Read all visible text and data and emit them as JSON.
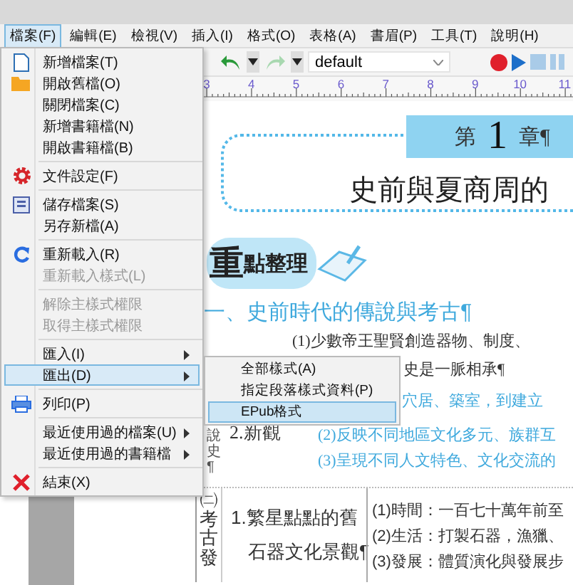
{
  "menu_bar": {
    "items": [
      {
        "label": "檔案(F)",
        "selected": true
      },
      {
        "label": "編輯(E)",
        "selected": false
      },
      {
        "label": "檢視(V)",
        "selected": false
      },
      {
        "label": "插入(I)",
        "selected": false
      },
      {
        "label": "格式(O)",
        "selected": false
      },
      {
        "label": "表格(A)",
        "selected": false
      },
      {
        "label": "書眉(P)",
        "selected": false
      },
      {
        "label": "工具(T)",
        "selected": false
      },
      {
        "label": "說明(H)",
        "selected": false
      }
    ]
  },
  "file_menu": {
    "items": [
      {
        "kind": "item",
        "label": "新增檔案(T)",
        "disabled": false,
        "submenu": false,
        "selected": false
      },
      {
        "kind": "item",
        "label": "開啟舊檔(O)",
        "disabled": false,
        "submenu": false,
        "selected": false
      },
      {
        "kind": "item",
        "label": "關閉檔案(C)",
        "disabled": false,
        "submenu": false,
        "selected": false
      },
      {
        "kind": "item",
        "label": "新增書籍檔(N)",
        "disabled": false,
        "submenu": false,
        "selected": false
      },
      {
        "kind": "item",
        "label": "開啟書籍檔(B)",
        "disabled": false,
        "submenu": false,
        "selected": false
      },
      {
        "kind": "separator"
      },
      {
        "kind": "item",
        "label": "文件設定(F)",
        "disabled": false,
        "submenu": false,
        "selected": false
      },
      {
        "kind": "separator"
      },
      {
        "kind": "item",
        "label": "儲存檔案(S)",
        "disabled": false,
        "submenu": false,
        "selected": false
      },
      {
        "kind": "item",
        "label": "另存新檔(A)",
        "disabled": false,
        "submenu": false,
        "selected": false
      },
      {
        "kind": "separator"
      },
      {
        "kind": "item",
        "label": "重新載入(R)",
        "disabled": false,
        "submenu": false,
        "selected": false
      },
      {
        "kind": "item",
        "label": "重新載入樣式(L)",
        "disabled": true,
        "submenu": false,
        "selected": false
      },
      {
        "kind": "separator"
      },
      {
        "kind": "item",
        "label": "解除主樣式權限",
        "disabled": true,
        "submenu": false,
        "selected": false
      },
      {
        "kind": "item",
        "label": "取得主樣式權限",
        "disabled": true,
        "submenu": false,
        "selected": false
      },
      {
        "kind": "separator"
      },
      {
        "kind": "item",
        "label": "匯入(I)",
        "disabled": false,
        "submenu": true,
        "selected": false
      },
      {
        "kind": "item",
        "label": "匯出(D)",
        "disabled": false,
        "submenu": true,
        "selected": true
      },
      {
        "kind": "separator"
      },
      {
        "kind": "item",
        "label": "列印(P)",
        "disabled": false,
        "submenu": false,
        "selected": false
      },
      {
        "kind": "separator"
      },
      {
        "kind": "item",
        "label": "最近使用過的檔案(U)",
        "disabled": false,
        "submenu": true,
        "selected": false
      },
      {
        "kind": "item",
        "label": "最近使用過的書籍檔",
        "disabled": false,
        "submenu": true,
        "selected": false
      },
      {
        "kind": "separator"
      },
      {
        "kind": "item",
        "label": "結束(X)",
        "disabled": false,
        "submenu": false,
        "selected": false
      }
    ]
  },
  "export_submenu": {
    "items": [
      {
        "label": "全部樣式(A)",
        "selected": false
      },
      {
        "label": "指定段落樣式資料(P)",
        "selected": false
      },
      {
        "label": "EPub格式",
        "selected": true
      }
    ]
  },
  "toolbar": {
    "style_select": {
      "value": "default"
    }
  },
  "ruler": {
    "labels": [
      "3",
      "4",
      "5",
      "6",
      "7",
      "8",
      "9",
      "10",
      "11"
    ]
  },
  "document": {
    "chapter_banner": {
      "prefix": "第",
      "number": "1",
      "suffix": "章¶"
    },
    "chapter_title": "史前與夏商周的",
    "section_badge": {
      "first": "重",
      "rest": "點整理"
    },
    "heading": "一、史前時代的傳說與考古¶",
    "side_label": "說史¶",
    "sub_label": "2.新觀",
    "outline": [
      {
        "text": "(1)少數帝王聖賢創造器物、制度、",
        "kind": "plain"
      },
      {
        "text": "史是一脈相承¶",
        "kind": "plain"
      },
      {
        "text": "穴居、築室，到建立",
        "kind": "highlight"
      },
      {
        "text": "(2)反映不同地區文化多元、族群互",
        "kind": "highlight"
      },
      {
        "text": "(3)呈現不同人文特色、文化交流的",
        "kind": "highlight"
      }
    ],
    "table": {
      "side_heading": "㈡考古發",
      "item_lines": [
        "1.繁星點點的舊",
        "石器文化景觀¶"
      ],
      "details": [
        "(1)時間：一百七十萬年前至",
        "(2)生活：打製石器，漁獵、",
        "(3)發展：體質演化與發展步"
      ]
    }
  }
}
